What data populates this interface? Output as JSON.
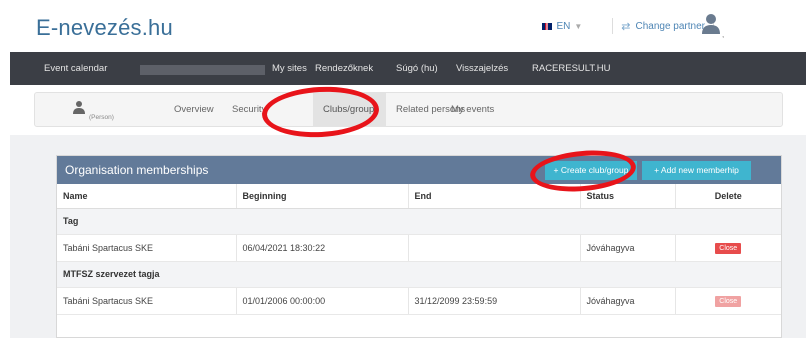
{
  "header": {
    "logo": "E-nevezés.hu",
    "language": "EN",
    "change_partner": "Change partner",
    "user_suffix": ","
  },
  "navbar": {
    "items": [
      "Event calendar",
      "My sites",
      "Rendezőknek",
      "Súgó (hu)",
      "Visszajelzés",
      "RACERESULT.HU"
    ]
  },
  "subnav": {
    "person_label": "(Person)",
    "tabs": [
      "Overview",
      "Security",
      "Clubs/groups",
      "Related persons",
      "My events"
    ],
    "active_tab": "Clubs/groups"
  },
  "panel": {
    "title": "Organisation memberships",
    "create_button": "+ Create club/group",
    "add_button": "+ Add new memberhip",
    "columns": [
      "Name",
      "Beginning",
      "End",
      "Status",
      "Delete"
    ],
    "groups": [
      {
        "label": "Tag",
        "rows": [
          {
            "name": "Tabáni Spartacus SKE",
            "beginning": "06/04/2021 18:30:22",
            "end": "",
            "status": "Jóváhagyva",
            "delete": "Close"
          }
        ]
      },
      {
        "label": "MTFSZ szervezet tagja",
        "rows": [
          {
            "name": "Tabáni Spartacus SKE",
            "beginning": "01/01/2006 00:00:00",
            "end": "31/12/2099 23:59:59",
            "status": "Jóváhagyva",
            "delete": "Close"
          }
        ]
      }
    ]
  },
  "colors": {
    "navbar": "#3b3e45",
    "panel_header": "#627a99",
    "button": "#3fb5cf",
    "delete": "#e74c4c",
    "annotation": "#e8141a"
  }
}
